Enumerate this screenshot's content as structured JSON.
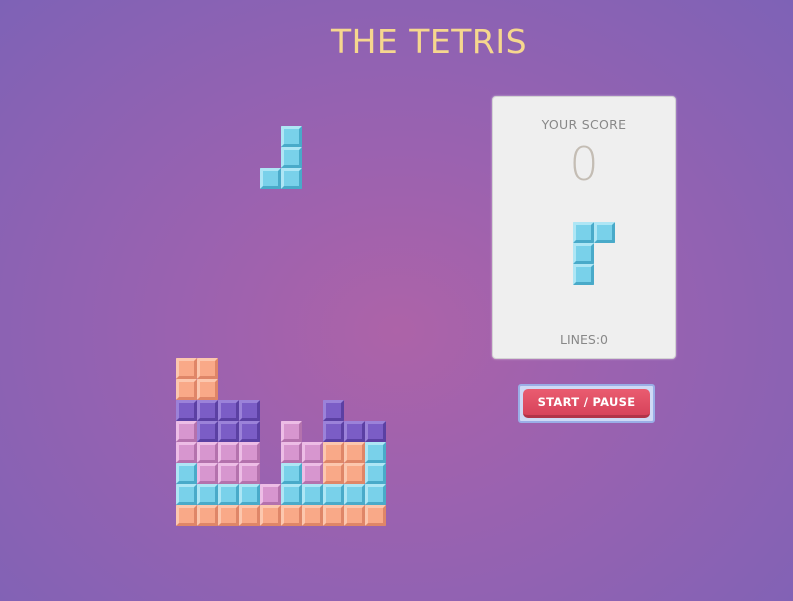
{
  "title": "THE TETRIS",
  "score": {
    "label": "YOUR SCORE",
    "value": "0"
  },
  "lines_label": "LINES:0",
  "start_pause_label": "START / PAUSE",
  "colors": {
    "cyan": "#79d1ea",
    "orange": "#f9a988",
    "purple": "#7b5dc6",
    "pink": "#d796cf",
    "title": "#f6d78e",
    "button": "#e0506a"
  },
  "board": {
    "columns": 10,
    "stack_rows_bottom_up": [
      "OOOOOOOOOO",
      "CCCCPCCCCC",
      "CPPP.CPOOC",
      "PPPP.PPOOC",
      "PVVV.P.VVV",
      "VVVV...V..",
      "OO........",
      "OO........"
    ],
    "falling_piece": {
      "color": "cyan",
      "cells": [
        [
          5,
          0
        ],
        [
          5,
          1
        ],
        [
          4,
          2
        ],
        [
          5,
          2
        ]
      ]
    }
  },
  "next_piece": {
    "color": "cyan",
    "cells": [
      [
        0,
        0
      ],
      [
        1,
        0
      ],
      [
        0,
        1
      ],
      [
        0,
        2
      ]
    ]
  }
}
